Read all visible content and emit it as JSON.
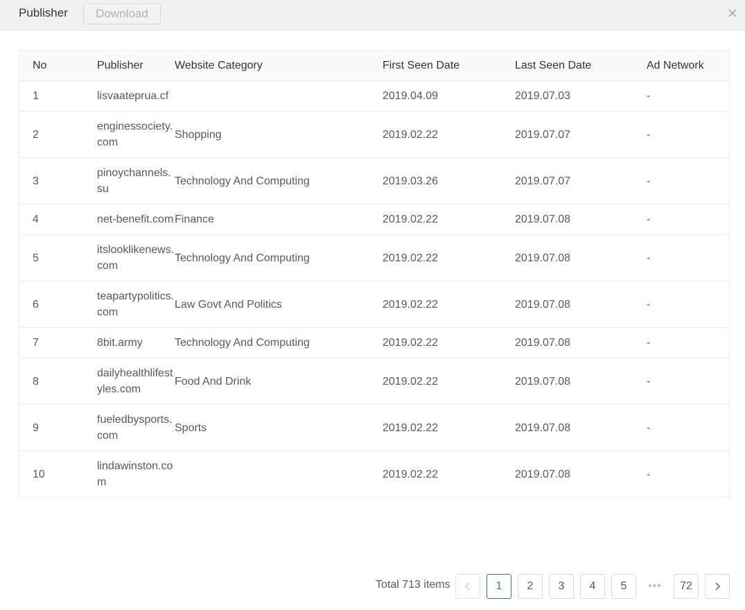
{
  "header": {
    "title": "Publisher",
    "download_label": "Download"
  },
  "table": {
    "columns": [
      "No",
      "Publisher",
      "Website Category",
      "First Seen Date",
      "Last Seen Date",
      "Ad Network"
    ],
    "rows": [
      {
        "no": "1",
        "publisher": "lisvaatepr​ua.cf",
        "category": "",
        "first": "2019.04.09",
        "last": "2019.07.03",
        "ad": "-"
      },
      {
        "no": "2",
        "publisher": "enginesso​ciety.com",
        "category": "Shopping",
        "first": "2019.02.22",
        "last": "2019.07.07",
        "ad": "-"
      },
      {
        "no": "3",
        "publisher": "pinoychan​nels.su",
        "category": "Technology And Computing",
        "first": "2019.03.26",
        "last": "2019.07.07",
        "ad": "-"
      },
      {
        "no": "4",
        "publisher": "net-​benefit.co​m",
        "category": "Finance",
        "first": "2019.02.22",
        "last": "2019.07.08",
        "ad": "-"
      },
      {
        "no": "5",
        "publisher": "itslooklike​news.com",
        "category": "Technology And Computing",
        "first": "2019.02.22",
        "last": "2019.07.08",
        "ad": "-"
      },
      {
        "no": "6",
        "publisher": "teapartypo​litics.com",
        "category": "Law Govt And Politics",
        "first": "2019.02.22",
        "last": "2019.07.08",
        "ad": "-"
      },
      {
        "no": "7",
        "publisher": "8bit.army",
        "category": "Technology And Computing",
        "first": "2019.02.22",
        "last": "2019.07.08",
        "ad": "-"
      },
      {
        "no": "8",
        "publisher": "dailyhealth​lifestyles.c​om",
        "category": "Food And Drink",
        "first": "2019.02.22",
        "last": "2019.07.08",
        "ad": "-"
      },
      {
        "no": "9",
        "publisher": "fueledbys​ports.com",
        "category": "Sports",
        "first": "2019.02.22",
        "last": "2019.07.08",
        "ad": "-"
      },
      {
        "no": "10",
        "publisher": "lindawinst​on.com",
        "category": "",
        "first": "2019.02.22",
        "last": "2019.07.08",
        "ad": "-"
      }
    ]
  },
  "pagination": {
    "total_label": "Total 713 items",
    "pages": [
      "1",
      "2",
      "3",
      "4",
      "5"
    ],
    "current_page": "1",
    "ellipsis": "•••",
    "last_page": "72"
  },
  "icons": {
    "close": "close-icon",
    "prev": "chevron-left-icon",
    "next": "chevron-right-icon"
  },
  "colors": {
    "accent": "#2a7f86",
    "header_bg": "#eff0f2"
  }
}
